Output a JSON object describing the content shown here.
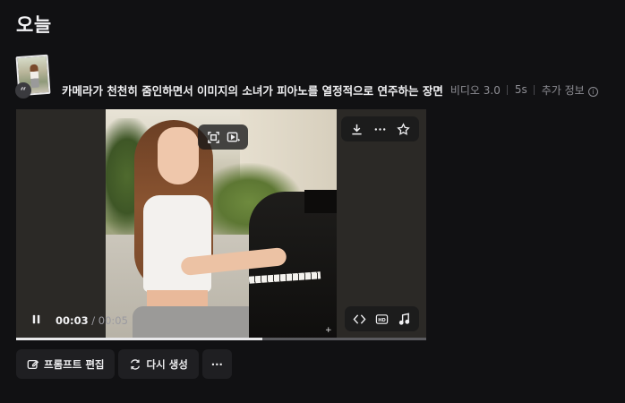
{
  "section": {
    "title": "오늘"
  },
  "task": {
    "prompt": "카메라가 천천히 줌인하면서 이미지의 소녀가 피아노를 열정적으로 연주하는 장면",
    "model": "비디오 3.0",
    "duration": "5s",
    "more_info": "추가 정보"
  },
  "player": {
    "current_time": "00:03",
    "total_time": " / 00:05",
    "progress": 0.6,
    "top_center_icons": [
      "crop-resize-icon",
      "video-extend-icon"
    ],
    "top_right_icons": [
      "download-icon",
      "more-options-icon",
      "favorite-star-icon"
    ],
    "bottom_right_icons": [
      "extend-icon",
      "hd-upscale-icon",
      "add-audio-icon"
    ],
    "play_state_icon": "pause-icon"
  },
  "actions": {
    "edit_prompt": "프롬프트 편집",
    "regenerate": "다시 생성",
    "more": "···"
  },
  "colors": {
    "background": "#111113",
    "surface": "#1f1f22",
    "text": "#f0f0f2",
    "muted": "#8e8e94"
  }
}
